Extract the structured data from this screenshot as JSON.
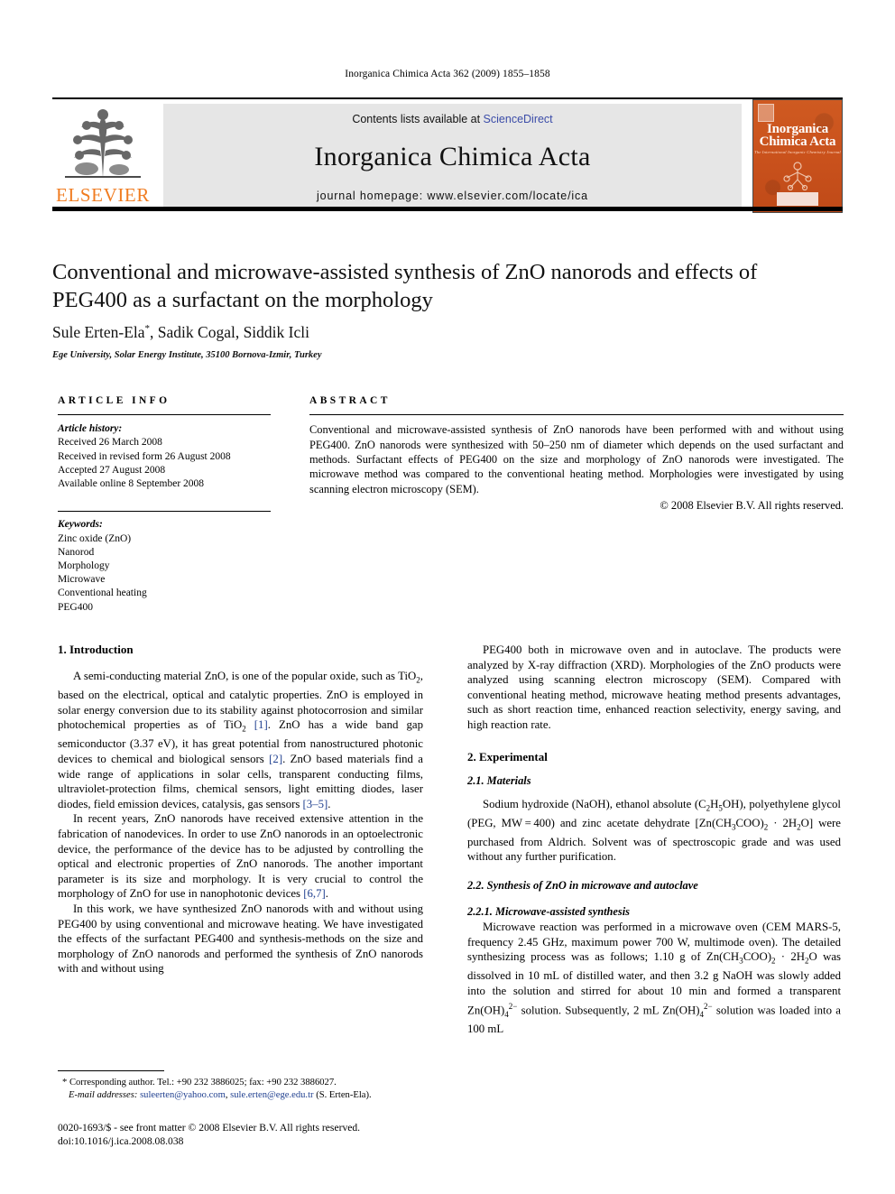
{
  "running_head": "Inorganica Chimica Acta 362 (2009) 1855–1858",
  "masthead": {
    "publisher": "ELSEVIER",
    "contents_prefix": "Contents lists available at ",
    "sciencedirect": "ScienceDirect",
    "journal_name": "Inorganica Chimica Acta",
    "homepage": "journal homepage: www.elsevier.com/locate/ica",
    "cover": {
      "line1": "Inorganica",
      "line2": "Chimica Acta",
      "subtitle": "The International Inorganic Chemistry Journal"
    },
    "colors": {
      "band": "#e6e6e6",
      "elsevier_orange": "#f07c21",
      "link_blue": "#3b4ca8",
      "cover_orange": "#c9511c"
    }
  },
  "article": {
    "title": "Conventional and microwave-assisted synthesis of ZnO nanorods and effects of PEG400 as a surfactant on the morphology",
    "authors": "Sule Erten-Ela",
    "authors_rest": ", Sadik Cogal, Siddik Icli",
    "author_marker": "*",
    "affiliation": "Ege University, Solar Energy Institute, 35100 Bornova-Izmir, Turkey"
  },
  "article_info": {
    "heading": "ARTICLE INFO",
    "history_label": "Article history:",
    "history": [
      "Received 26 March 2008",
      "Received in revised form 26 August 2008",
      "Accepted 27 August 2008",
      "Available online 8 September 2008"
    ],
    "keywords_label": "Keywords:",
    "keywords": [
      "Zinc oxide (ZnO)",
      "Nanorod",
      "Morphology",
      "Microwave",
      "Conventional heating",
      "PEG400"
    ]
  },
  "abstract": {
    "heading": "ABSTRACT",
    "body": "Conventional and microwave-assisted synthesis of ZnO nanorods have been performed with and without using PEG400. ZnO nanorods were synthesized with 50–250 nm of diameter which depends on the used surfactant and methods. Surfactant effects of PEG400 on the size and morphology of ZnO nanorods were investigated. The microwave method was compared to the conventional heating method. Morphologies were investigated by using scanning electron microscopy (SEM).",
    "copyright": "© 2008 Elsevier B.V. All rights reserved."
  },
  "sections": {
    "intro_heading": "1. Introduction",
    "intro_p1_a": "A semi-conducting material ZnO, is one of the popular oxide, such as TiO",
    "intro_p1_b": ", based on the electrical, optical and catalytic properties. ZnO is employed in solar energy conversion due to its stability against photocorrosion and similar photochemical properties as of TiO",
    "intro_p1_ref1": "[1]",
    "intro_p1_c": ". ZnO has a wide band gap semiconductor (3.37 eV), it has great potential from nanostructured photonic devices to chemical and biological sensors ",
    "intro_p1_ref2": "[2]",
    "intro_p1_d": ". ZnO based materials find a wide range of applications in solar cells, transparent conducting films, ultraviolet-protection films, chemical sensors, light emitting diodes, laser diodes, field emission devices, catalysis, gas sensors ",
    "intro_p1_ref3": "[3–5]",
    "intro_p1_e": ".",
    "intro_p2_a": "In recent years, ZnO nanorods have received extensive attention in the fabrication of nanodevices. In order to use ZnO nanorods in an optoelectronic device, the performance of the device has to be adjusted by controlling the optical and electronic properties of ZnO nanorods. The another important parameter is its size and morphology. It is very crucial to control the morphology of ZnO for use in nanophotonic devices ",
    "intro_p2_ref": "[6,7]",
    "intro_p2_b": ".",
    "intro_p3": "In this work, we have synthesized ZnO nanorods with and without using PEG400 by using conventional and microwave heating. We have investigated the effects of the surfactant PEG400 and synthesis-methods on the size and morphology of ZnO nanorods and performed the synthesis of ZnO nanorods with and without using",
    "right_p1": "PEG400 both in microwave oven and in autoclave. The products were analyzed by X-ray diffraction (XRD). Morphologies of the ZnO products were analyzed using scanning electron microscopy (SEM). Compared with conventional heating method, microwave heating method presents advantages, such as short reaction time, enhanced reaction selectivity, energy saving, and high reaction rate.",
    "experimental_heading": "2. Experimental",
    "materials_heading": "2.1. Materials",
    "materials_body_a": "Sodium hydroxide (NaOH), ethanol absolute (C",
    "materials_body_b": "OH), polyethylene glycol (PEG, MW = 400) and zinc acetate dehydrate [Zn(CH",
    "materials_body_c": "COO)",
    "materials_body_d": "O] were purchased from Aldrich. Solvent was of spectroscopic grade and was used without any further purification.",
    "synthesis_heading": "2.2. Synthesis of ZnO in microwave and autoclave",
    "micro_heading": "2.2.1. Microwave-assisted synthesis",
    "micro_body_a": "Microwave reaction was performed in a microwave oven (CEM MARS-5, frequency 2.45 GHz, maximum power 700 W, multimode oven). The detailed synthesizing process was as follows; 1.10 g of Zn(CH",
    "micro_body_b": "COO)",
    "micro_body_c": "O was dissolved in 10 mL of distilled water, and then 3.2 g NaOH was slowly added into the solution and stirred for about 10 min and formed a transparent Zn(OH)",
    "micro_body_d": " solution. Subsequently, 2 mL Zn(OH)",
    "micro_body_e": " solution was loaded into a 100 mL"
  },
  "footnote": {
    "corresponding": "* Corresponding author. Tel.: +90 232 3886025; fax: +90 232 3886027.",
    "email_label": "E-mail addresses:",
    "email1": "suleerten@yahoo.com",
    "email_sep": ", ",
    "email2": "sule.erten@ege.edu.tr",
    "email_tail": " (S. Erten-Ela).",
    "issn_line": "0020-1693/$ - see front matter © 2008 Elsevier B.V. All rights reserved.",
    "doi_line": "doi:10.1016/j.ica.2008.08.038"
  }
}
